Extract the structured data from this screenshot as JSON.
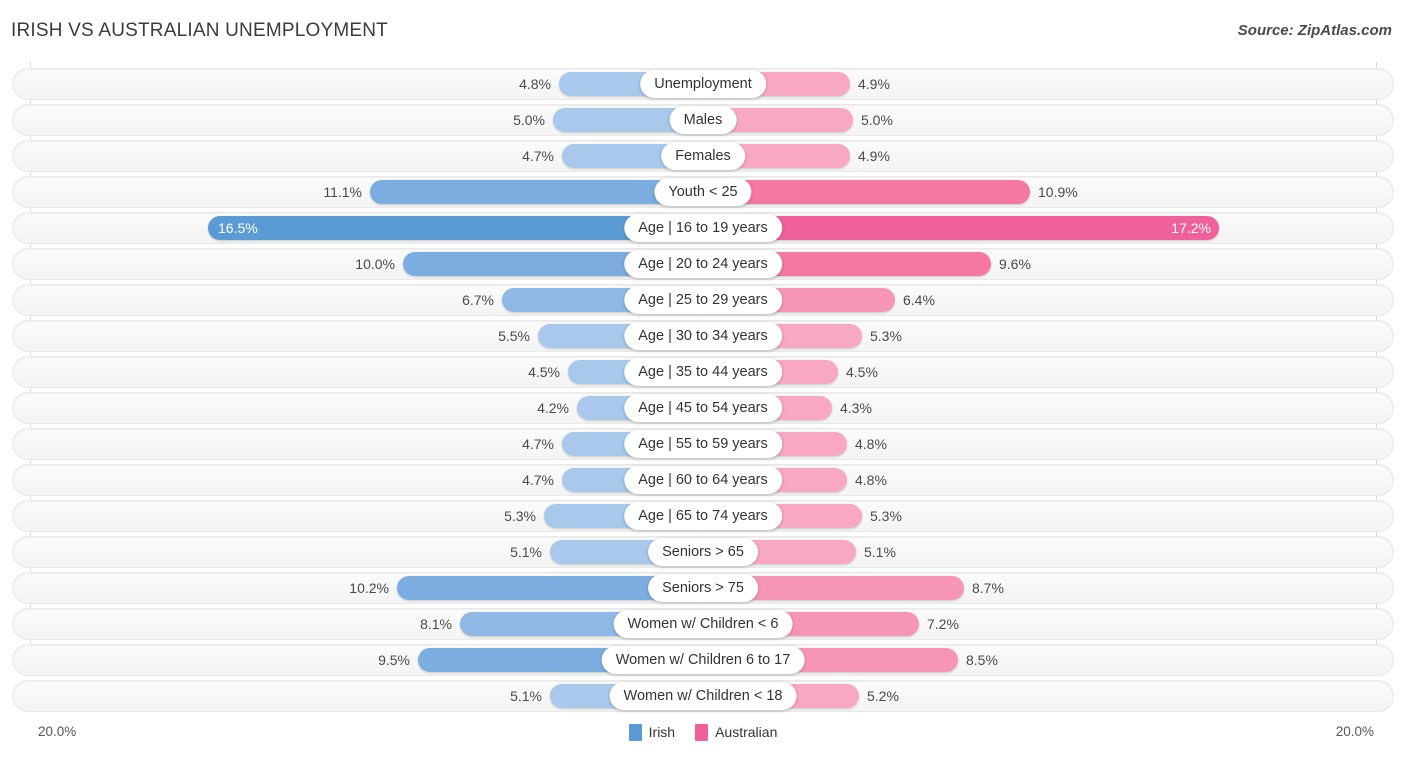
{
  "header": {
    "title": "IRISH VS AUSTRALIAN UNEMPLOYMENT",
    "source": "Source: ZipAtlas.com"
  },
  "axis": {
    "left_max_label": "20.0%",
    "right_max_label": "20.0%",
    "max": 20.0
  },
  "legend": {
    "items": [
      {
        "label": "Irish",
        "color": "#5b9bd5"
      },
      {
        "label": "Australian",
        "color": "#f0619a"
      }
    ]
  },
  "colors": {
    "irish_light": "#a8c9ec",
    "irish_mid": "#8fb8e4",
    "irish_strong": "#7cade0",
    "irish_dark": "#5b9bd5",
    "aus_light": "#f9a8c4",
    "aus_mid": "#f795b6",
    "aus_strong": "#f578a4",
    "aus_dark": "#f0619a",
    "track": "#f6f6f6",
    "grid": "#d6d6d6"
  },
  "chart_data": {
    "type": "bar",
    "title": "IRISH VS AUSTRALIAN UNEMPLOYMENT",
    "subtitle": "",
    "xlabel": "",
    "ylabel": "",
    "orientation": "horizontal-diverging",
    "axis_max": 20.0,
    "xlim": [
      20.0,
      20.0
    ],
    "grid": true,
    "legend_position": "bottom-center",
    "categories": [
      "Unemployment",
      "Males",
      "Females",
      "Youth < 25",
      "Age | 16 to 19 years",
      "Age | 20 to 24 years",
      "Age | 25 to 29 years",
      "Age | 30 to 34 years",
      "Age | 35 to 44 years",
      "Age | 45 to 54 years",
      "Age | 55 to 59 years",
      "Age | 60 to 64 years",
      "Age | 65 to 74 years",
      "Seniors > 65",
      "Seniors > 75",
      "Women w/ Children < 6",
      "Women w/ Children 6 to 17",
      "Women w/ Children < 18"
    ],
    "series": [
      {
        "name": "Irish",
        "color": "#5b9bd5",
        "values": [
          4.8,
          5.0,
          4.7,
          11.1,
          16.5,
          10.0,
          6.7,
          5.5,
          4.5,
          4.2,
          4.7,
          4.7,
          5.3,
          5.1,
          10.2,
          8.1,
          9.5,
          5.1
        ],
        "labels": [
          "4.8%",
          "5.0%",
          "4.7%",
          "11.1%",
          "16.5%",
          "10.0%",
          "6.7%",
          "5.5%",
          "4.5%",
          "4.2%",
          "4.7%",
          "4.7%",
          "5.3%",
          "5.1%",
          "10.2%",
          "8.1%",
          "9.5%",
          "5.1%"
        ]
      },
      {
        "name": "Australian",
        "color": "#f0619a",
        "values": [
          4.9,
          5.0,
          4.9,
          10.9,
          17.2,
          9.6,
          6.4,
          5.3,
          4.5,
          4.3,
          4.8,
          4.8,
          5.3,
          5.1,
          8.7,
          7.2,
          8.5,
          5.2
        ],
        "labels": [
          "4.9%",
          "5.0%",
          "4.9%",
          "10.9%",
          "17.2%",
          "9.6%",
          "6.4%",
          "5.3%",
          "4.5%",
          "4.3%",
          "4.8%",
          "4.8%",
          "5.3%",
          "5.1%",
          "8.7%",
          "7.2%",
          "8.5%",
          "5.2%"
        ]
      }
    ]
  },
  "rows": [
    {
      "label": "Unemployment",
      "left_value": 4.8,
      "left_label": "4.8%",
      "right_value": 4.9,
      "right_label": "4.9%"
    },
    {
      "label": "Males",
      "left_value": 5.0,
      "left_label": "5.0%",
      "right_value": 5.0,
      "right_label": "5.0%"
    },
    {
      "label": "Females",
      "left_value": 4.7,
      "left_label": "4.7%",
      "right_value": 4.9,
      "right_label": "4.9%"
    },
    {
      "label": "Youth < 25",
      "left_value": 11.1,
      "left_label": "11.1%",
      "right_value": 10.9,
      "right_label": "10.9%"
    },
    {
      "label": "Age | 16 to 19 years",
      "left_value": 16.5,
      "left_label": "16.5%",
      "right_value": 17.2,
      "right_label": "17.2%"
    },
    {
      "label": "Age | 20 to 24 years",
      "left_value": 10.0,
      "left_label": "10.0%",
      "right_value": 9.6,
      "right_label": "9.6%"
    },
    {
      "label": "Age | 25 to 29 years",
      "left_value": 6.7,
      "left_label": "6.7%",
      "right_value": 6.4,
      "right_label": "6.4%"
    },
    {
      "label": "Age | 30 to 34 years",
      "left_value": 5.5,
      "left_label": "5.5%",
      "right_value": 5.3,
      "right_label": "5.3%"
    },
    {
      "label": "Age | 35 to 44 years",
      "left_value": 4.5,
      "left_label": "4.5%",
      "right_value": 4.5,
      "right_label": "4.5%"
    },
    {
      "label": "Age | 45 to 54 years",
      "left_value": 4.2,
      "left_label": "4.2%",
      "right_value": 4.3,
      "right_label": "4.3%"
    },
    {
      "label": "Age | 55 to 59 years",
      "left_value": 4.7,
      "left_label": "4.7%",
      "right_value": 4.8,
      "right_label": "4.8%"
    },
    {
      "label": "Age | 60 to 64 years",
      "left_value": 4.7,
      "left_label": "4.7%",
      "right_value": 4.8,
      "right_label": "4.8%"
    },
    {
      "label": "Age | 65 to 74 years",
      "left_value": 5.3,
      "left_label": "5.3%",
      "right_value": 5.3,
      "right_label": "5.3%"
    },
    {
      "label": "Seniors > 65",
      "left_value": 5.1,
      "left_label": "5.1%",
      "right_value": 5.1,
      "right_label": "5.1%"
    },
    {
      "label": "Seniors > 75",
      "left_value": 10.2,
      "left_label": "10.2%",
      "right_value": 8.7,
      "right_label": "8.7%"
    },
    {
      "label": "Women w/ Children < 6",
      "left_value": 8.1,
      "left_label": "8.1%",
      "right_value": 7.2,
      "right_label": "7.2%"
    },
    {
      "label": "Women w/ Children 6 to 17",
      "left_value": 9.5,
      "left_label": "9.5%",
      "right_value": 8.5,
      "right_label": "8.5%"
    },
    {
      "label": "Women w/ Children < 18",
      "left_value": 5.1,
      "left_label": "5.1%",
      "right_value": 5.2,
      "right_label": "5.2%"
    }
  ]
}
